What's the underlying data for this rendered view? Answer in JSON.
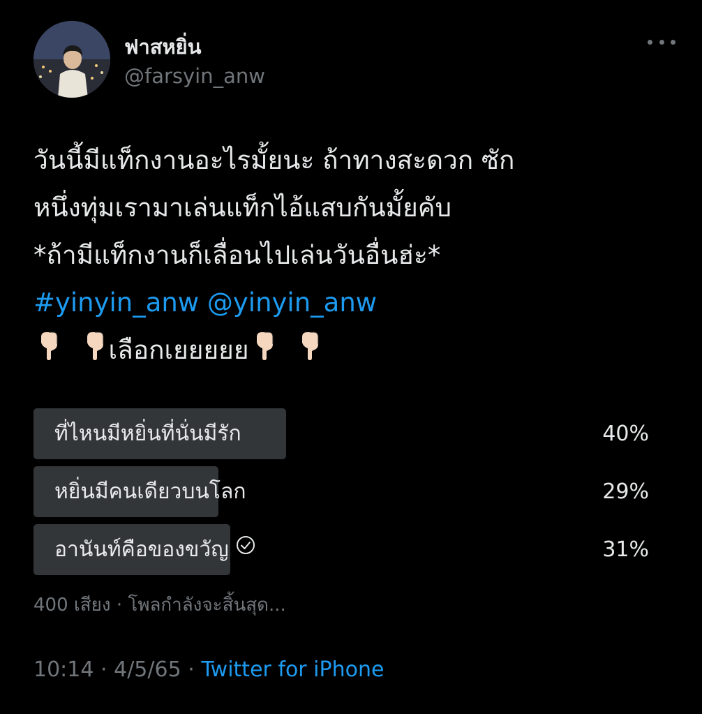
{
  "author": {
    "display_name": "ฟาสหยิ่น",
    "handle": "@farsyin_anw"
  },
  "tweet": {
    "line1": "วันนี้มีแท็กงานอะไรมั้ยนะ ถ้าทางสะดวก ซัก",
    "line2": "หนึ่งทุ่มเรามาเล่นแท็กไอ้แสบกันมั้ยคับ",
    "line3": "*ถ้ามีแท็กงานก็เลื่อนไปเล่นวันอื่นฮ่ะ*",
    "hashtag": "#yinyin_anw",
    "mention": "@yinyin_anw",
    "line5_text": "เลือกเยยยยย"
  },
  "poll": {
    "options": [
      {
        "label": "ที่ไหนมีหยิ่นที่นั่นมีรัก",
        "percent_text": "40%",
        "fraction": 0.41
      },
      {
        "label": "หยิ่นมีคนเดียวบนโลก",
        "percent_text": "29%",
        "fraction": 0.3
      },
      {
        "label": "อานันท์คือของขวัญ",
        "percent_text": "31%",
        "fraction": 0.32
      }
    ],
    "votes": "400 เสียง",
    "separator": "·",
    "status": "โพลกำลังจะสิ้นสุด..."
  },
  "meta": {
    "time": "10:14",
    "date": "4/5/65",
    "source": "Twitter for iPhone",
    "separator": "·"
  },
  "colors": {
    "background": "#000000",
    "text": "#e7e9ea",
    "muted": "#71767b",
    "link": "#1d9bf0",
    "poll_bar": "#333639"
  }
}
